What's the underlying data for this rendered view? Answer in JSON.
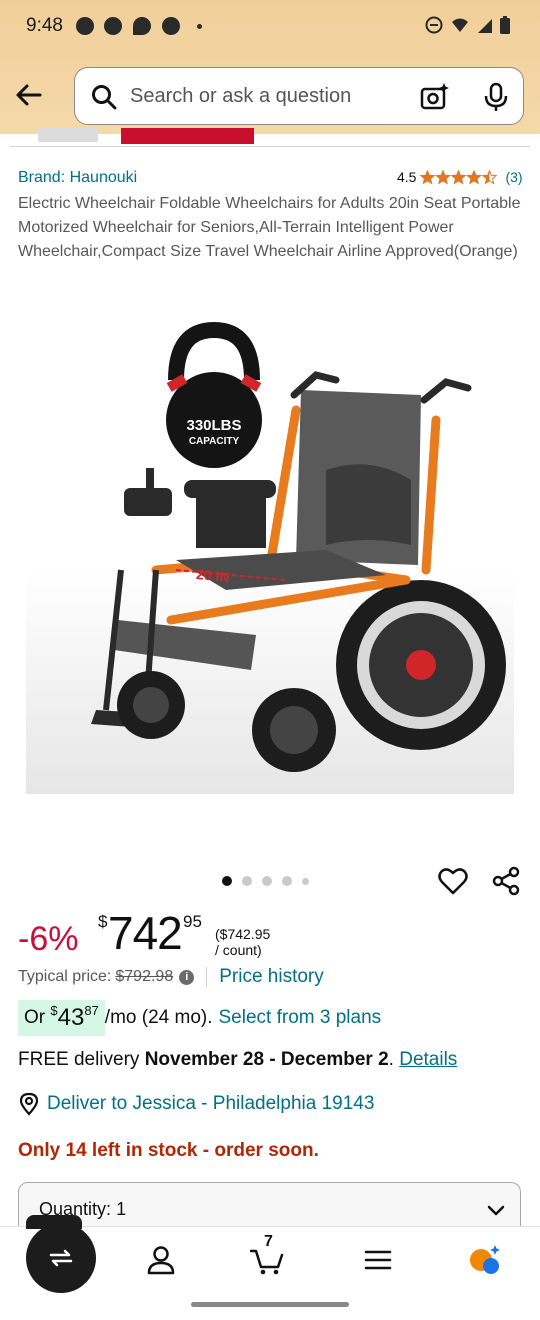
{
  "status_bar": {
    "time": "9:48",
    "notification_icons": [
      "messenger-icon",
      "messenger-icon",
      "chat-bubble-icon",
      "weather-icon"
    ],
    "system_icons": [
      "do-not-disturb-icon",
      "wifi-icon",
      "signal-icon",
      "battery-icon"
    ]
  },
  "header": {
    "back_icon": "arrow-left-icon",
    "search_placeholder": "Search or ask a question",
    "camera_icon": "camera-sparkle-icon",
    "mic_icon": "microphone-icon"
  },
  "product": {
    "brand": "Brand: Haunouki",
    "rating_value": "4.5",
    "rating_stars": 4.5,
    "rating_count": "(3)",
    "title": "Electric Wheelchair Foldable Wheelchairs for Adults 20in Seat Portable Motorized Wheelchair for Seniors,All-Terrain Intelligent Power Wheelchair,Compact Size Travel Wheelchair Airline Approved(Orange)",
    "image_weight_text": "330LBS",
    "image_capacity_text": "CAPACITY",
    "image_seat_text": "20 IN",
    "image_count": 5,
    "image_active_index": 0
  },
  "pricing": {
    "discount": "-6%",
    "currency": "$",
    "whole": "742",
    "fraction": "95",
    "unit_price": "($742.95 / count)",
    "typical_label": "Typical price:",
    "typical_value": "$792.98",
    "price_history": "Price history",
    "monthly_prefix": "Or",
    "monthly_currency": "$",
    "monthly_whole": "43",
    "monthly_fraction": "87",
    "monthly_suffix": "/mo (24 mo).",
    "plans_link": "Select from 3 plans"
  },
  "delivery": {
    "prefix": "FREE delivery",
    "dates": "November 28 - December 2",
    "period": ".",
    "details": "Details",
    "deliver_to": "Deliver to Jessica - Philadelphia 19143",
    "stock": "Only 14 left in stock - order soon."
  },
  "quantity": {
    "label": "Quantity:",
    "value": "1"
  },
  "bottom_nav": {
    "cart_count": "7",
    "items": [
      "switch-icon",
      "account-icon",
      "cart-icon",
      "menu-icon",
      "rufus-icon"
    ]
  },
  "colors": {
    "header_bg": "#f1cf9a",
    "link": "#007185",
    "discount": "#cc0c39",
    "stock": "#b12704",
    "star": "#de7921",
    "wheelchair_frame": "#e87b1e"
  }
}
